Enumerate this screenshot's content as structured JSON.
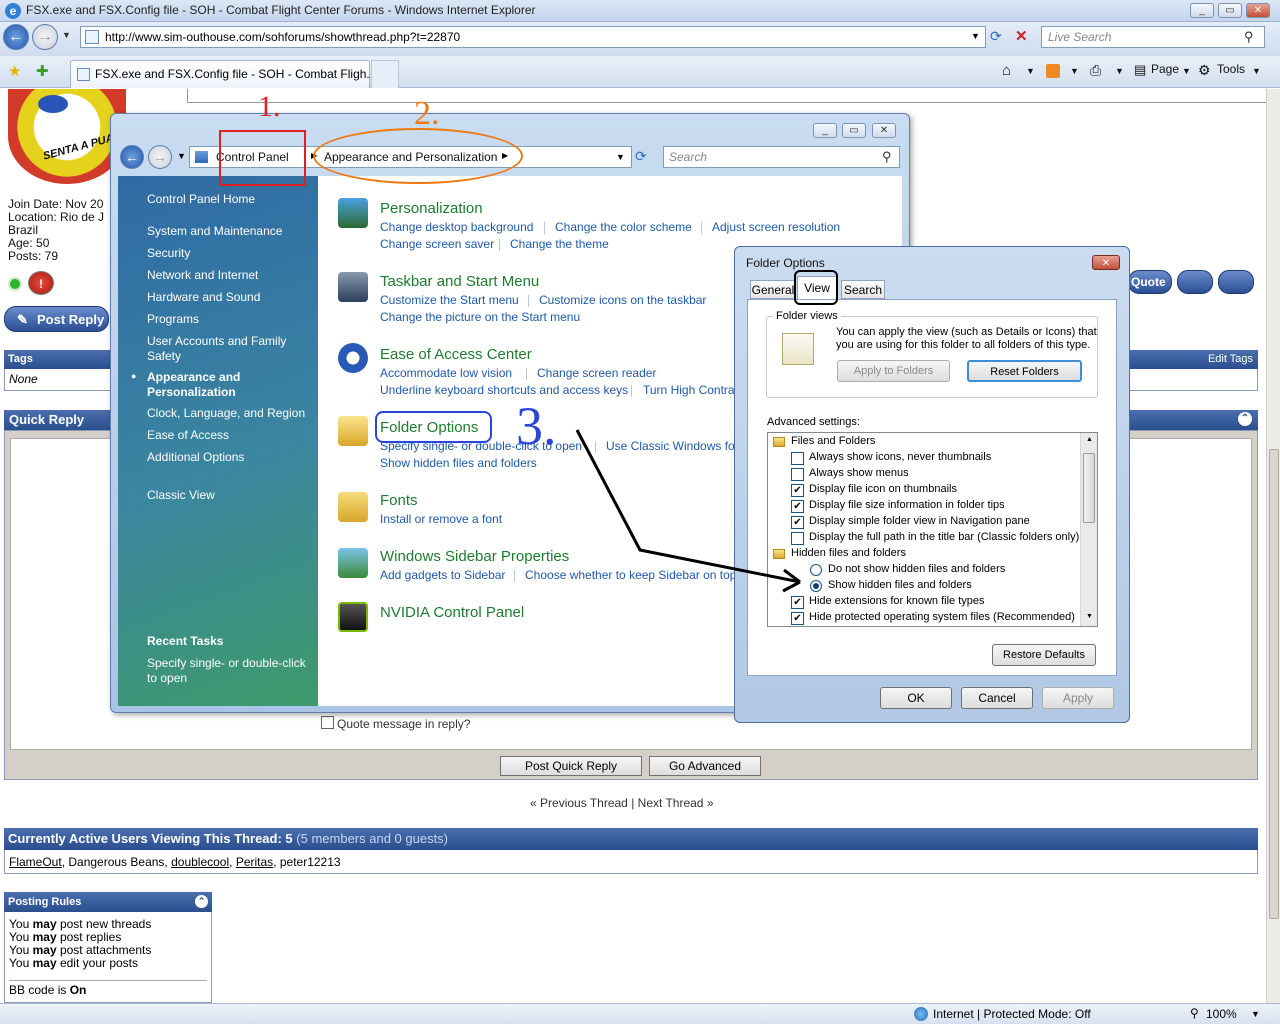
{
  "browser": {
    "window_title": "FSX.exe and FSX.Config file - SOH - Combat Flight Center Forums - Windows Internet Explorer",
    "address": "http://www.sim-outhouse.com/sohforums/showthread.php?t=22870",
    "search_placeholder": "Live Search",
    "tab_title": "FSX.exe and FSX.Config file - SOH - Combat Fligh...",
    "toolbar": {
      "page": "Page",
      "tools": "Tools"
    }
  },
  "forum": {
    "profile": {
      "join": "Join Date: Nov 20",
      "location": "Location: Rio de J",
      "country": "Brazil",
      "age": "Age: 50",
      "posts": "Posts: 79",
      "logo_text": "SENTA A PUA!"
    },
    "post_reply": "Post Reply",
    "quote_btn": "Quote",
    "tags_header": "Tags",
    "edit_tags": "Edit Tags",
    "tags_value": "None",
    "quick_reply_header": "Quick Reply",
    "quote_message": "Quote message in reply?",
    "post_quick_reply": "Post Quick Reply",
    "go_advanced": "Go Advanced",
    "prev_thread": "Previous Thread",
    "thread_sep": "|",
    "next_thread": "Next Thread",
    "active_users_header": "Currently Active Users Viewing This Thread: 5",
    "active_users_sub": "(5 members and 0 guests)",
    "users": [
      "FlameOut",
      ", Dangerous Beans, ",
      "doublecool",
      ", ",
      "Peritas",
      ", peter12213"
    ],
    "posting_rules_header": "Posting Rules",
    "rules": [
      {
        "a": "You ",
        "b": "may",
        "c": " post new threads"
      },
      {
        "a": "You ",
        "b": "may",
        "c": " post replies"
      },
      {
        "a": "You ",
        "b": "may",
        "c": " post attachments"
      },
      {
        "a": "You ",
        "b": "may",
        "c": " edit your posts"
      }
    ],
    "bbcode": "BB code is ",
    "bbcode_val": "On"
  },
  "control_panel": {
    "breadcrumb_root": "Control Panel",
    "breadcrumb_current": "Appearance and Personalization",
    "search_placeholder": "Search",
    "sidebar": {
      "home": "Control Panel Home",
      "items": [
        "System and Maintenance",
        "Security",
        "Network and Internet",
        "Hardware and Sound",
        "Programs",
        "User Accounts and Family",
        "Safety",
        "Appearance and",
        "Personalization",
        "Clock, Language, and Region",
        "Ease of Access",
        "Additional Options"
      ],
      "classic_view": "Classic View",
      "recent_tasks": "Recent Tasks",
      "recent_1": "Specify single- or double-click",
      "recent_2": "to open"
    },
    "categories": {
      "personalization": {
        "title": "Personalization",
        "links": [
          "Change desktop background",
          "Change the color scheme",
          "Adjust screen resolution",
          "Change screen saver",
          "Change the theme"
        ]
      },
      "taskbar": {
        "title": "Taskbar and Start Menu",
        "links": [
          "Customize the Start menu",
          "Customize icons on the taskbar",
          "Change the picture on the Start menu"
        ]
      },
      "ease": {
        "title": "Ease of Access Center",
        "links": [
          "Accommodate low vision",
          "Change screen reader",
          "Underline keyboard shortcuts and access keys",
          "Turn High Contra"
        ]
      },
      "folder": {
        "title": "Folder Options",
        "links": [
          "Specify single- or double-click to open",
          "Use Classic Windows fol",
          "Show hidden files and folders"
        ]
      },
      "fonts": {
        "title": "Fonts",
        "links": [
          "Install or remove a font"
        ]
      },
      "sidebar_props": {
        "title": "Windows Sidebar Properties",
        "links": [
          "Add gadgets to Sidebar",
          "Choose whether to keep Sidebar on top"
        ]
      },
      "nvidia": {
        "title": "NVIDIA Control Panel"
      }
    }
  },
  "folder_options": {
    "title": "Folder Options",
    "tabs": [
      "General",
      "View",
      "Search"
    ],
    "folder_views_label": "Folder views",
    "folder_views_text_1": "You can apply the view (such as Details or Icons) that",
    "folder_views_text_2": "you are using for this folder to all folders of this type.",
    "apply_to_folders": "Apply to Folders",
    "reset_folders": "Reset Folders",
    "advanced_label": "Advanced settings:",
    "tree": [
      {
        "text": "Files and Folders",
        "kind": "folder",
        "checked": false
      },
      {
        "text": "Always show icons, never thumbnails",
        "kind": "check",
        "checked": false
      },
      {
        "text": "Always show menus",
        "kind": "check",
        "checked": false
      },
      {
        "text": "Display file icon on thumbnails",
        "kind": "check",
        "checked": true
      },
      {
        "text": "Display file size information in folder tips",
        "kind": "check",
        "checked": true
      },
      {
        "text": "Display simple folder view in Navigation pane",
        "kind": "check",
        "checked": true
      },
      {
        "text": "Display the full path in the title bar (Classic folders only)",
        "kind": "check",
        "checked": false
      },
      {
        "text": "Hidden files and folders",
        "kind": "folder",
        "checked": false
      },
      {
        "text": "Do not show hidden files and folders",
        "kind": "radio",
        "checked": false
      },
      {
        "text": "Show hidden files and folders",
        "kind": "radio",
        "checked": true
      },
      {
        "text": "Hide extensions for known file types",
        "kind": "check",
        "checked": true
      },
      {
        "text": "Hide protected operating system files (Recommended)",
        "kind": "check",
        "checked": true
      }
    ],
    "restore_defaults": "Restore Defaults",
    "ok": "OK",
    "cancel": "Cancel",
    "apply": "Apply"
  },
  "annotations": {
    "one": "1.",
    "two": "2.",
    "three": "3."
  },
  "status": {
    "zone": "Internet | Protected Mode: Off",
    "zoom": "100%"
  },
  "colors": {
    "annotation_red": "#e02020",
    "annotation_orange": "#f07810",
    "annotation_blue": "#2a46d8",
    "cp_green_title": "#1e7b2f",
    "link_blue": "#1f5aa8",
    "forum_navy": "#2a4e8e"
  }
}
